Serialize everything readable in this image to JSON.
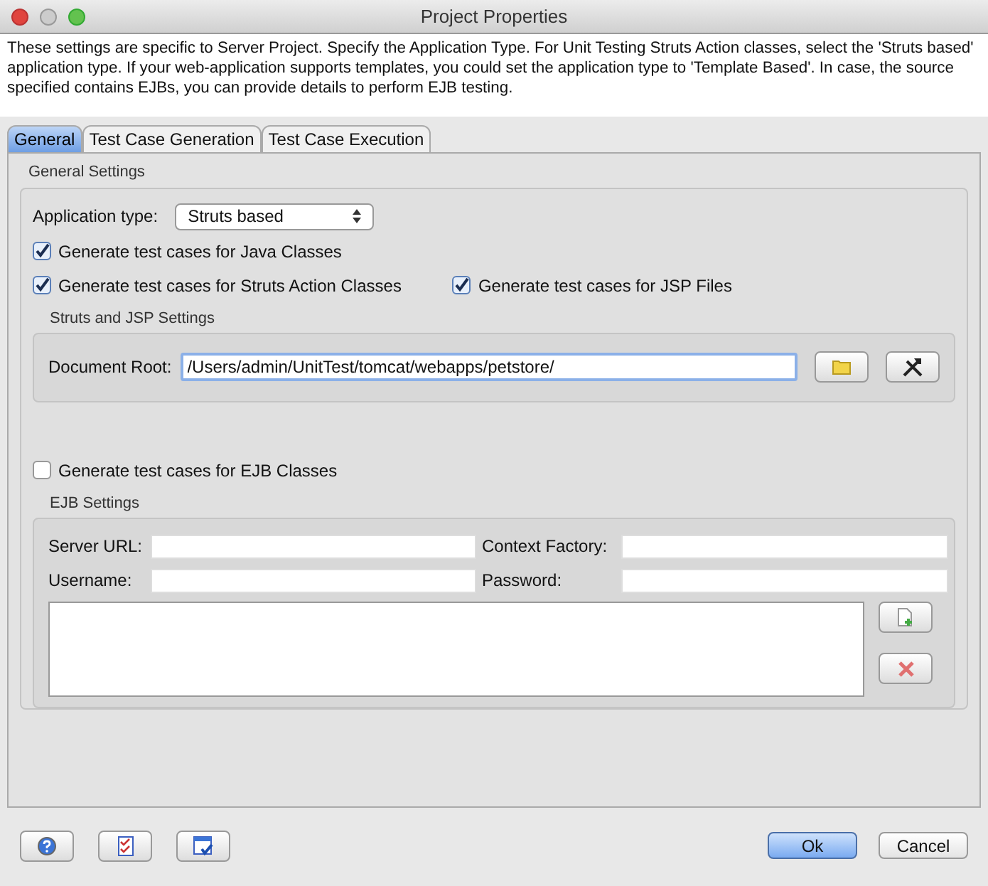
{
  "window": {
    "title": "Project Properties"
  },
  "description": "These settings are specific to Server Project. Specify the Application Type. For Unit Testing Struts Action classes, select the 'Struts based' application type. If your web-application supports templates, you could set the application type to 'Template Based'. In case, the source specified contains EJBs, you can provide details to perform EJB testing.",
  "tabs": [
    {
      "label": "General",
      "selected": true
    },
    {
      "label": "Test Case Generation",
      "selected": false
    },
    {
      "label": "Test Case Execution",
      "selected": false
    }
  ],
  "general_settings": {
    "title": "General Settings",
    "application_type": {
      "label": "Application type:",
      "value": "Struts based"
    },
    "java_classes": {
      "label": "Generate test cases for Java Classes",
      "checked": true
    },
    "struts_action_classes": {
      "label": "Generate test cases for Struts Action Classes",
      "checked": true
    },
    "jsp_files": {
      "label": "Generate test cases for JSP Files",
      "checked": true
    },
    "struts_jsp_settings": {
      "title": "Struts and JSP Settings",
      "document_root": {
        "label": "Document Root:",
        "value": "/Users/admin/UnitTest/tomcat/webapps/petstore/"
      }
    },
    "ejb_classes": {
      "label": "Generate test cases for EJB Classes",
      "checked": false
    },
    "ejb_settings": {
      "title": "EJB Settings",
      "fields": [
        {
          "label": "Server URL:"
        },
        {
          "label": "Context Factory:"
        },
        {
          "label": "Username:"
        },
        {
          "label": "Password:"
        }
      ]
    }
  },
  "buttons": [
    {
      "label": "Ok",
      "default": true
    },
    {
      "label": "Cancel",
      "default": false
    }
  ]
}
